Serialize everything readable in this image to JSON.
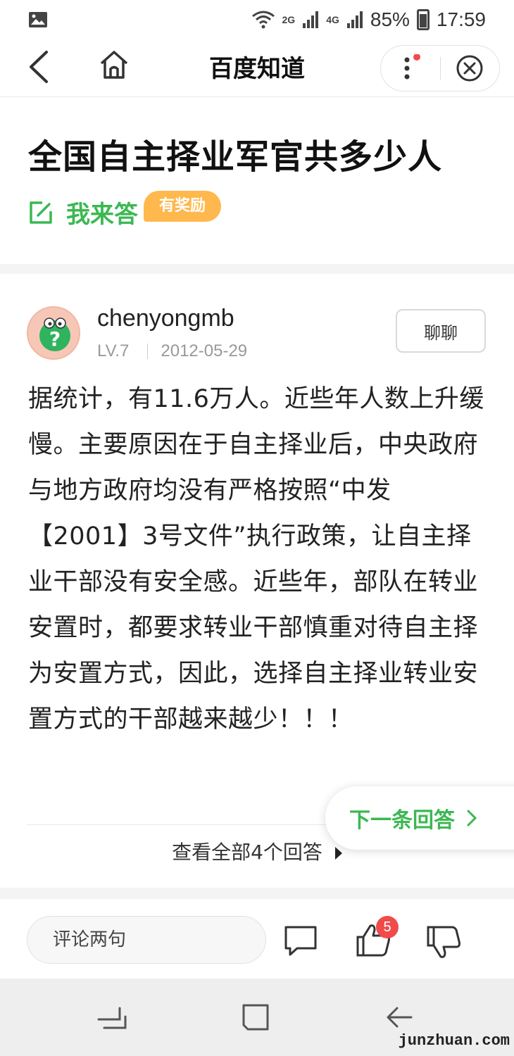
{
  "status_bar": {
    "net_labels": [
      "2G",
      "4G"
    ],
    "battery": "85%",
    "time": "17:59"
  },
  "nav": {
    "title": "百度知道",
    "icons": [
      "back-icon",
      "home-icon",
      "more-icon",
      "close-icon"
    ]
  },
  "question": {
    "title": "全国自主择业军官共多少人",
    "answer_button": "我来答",
    "reward_badge": "有奖励"
  },
  "answer": {
    "user_name": "chenyongmb",
    "level": "LV.7",
    "date": "2012-05-29",
    "chat_button": "聊聊",
    "body": "据统计，有11.6万人。近些年人数上升缓慢。主要原因在于自主择业后，中央政府与地方政府均没有严格按照“中发【2001】3号文件”执行政策，让自主择业干部没有安全感。近些年，部队在转业安置时，都要求转业干部慎重对待自主择为安置方式，因此，选择自主择业转业安置方式的干部越来越少！！！",
    "view_all": "查看全部4个回答",
    "next_answer": "下一条回答"
  },
  "action_bar": {
    "comment_placeholder": "评论两句",
    "like_count": "5"
  },
  "watermark": "junzhuan.com",
  "colors": {
    "brand_green": "#3cb853",
    "reward_orange": "#ffb84d",
    "badge_red": "#f04b4b"
  }
}
